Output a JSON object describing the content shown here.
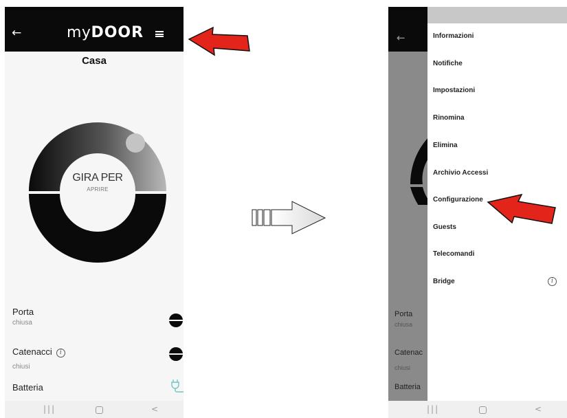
{
  "left_screen": {
    "app_bar": {
      "back_icon": "arrow-left-icon",
      "logo_my": "my",
      "logo_door": "DOOR",
      "menu_icon": "hamburger-menu-icon"
    },
    "title": "Casa",
    "dial": {
      "main_text": "GIRA PER",
      "sub_text": "APRIRE"
    },
    "status": {
      "porta": {
        "label": "Porta",
        "value": "chiusa"
      },
      "catenacci": {
        "label": "Catenacci",
        "value": "chiusi"
      },
      "batteria": {
        "label": "Batteria"
      }
    },
    "nav": {
      "recent": "|||",
      "back": "<"
    }
  },
  "right_screen": {
    "background": {
      "porta_label": "Porta",
      "porta_value": "chiusa",
      "catenacci_label": "Catenac",
      "catenacci_value": "chiusi",
      "batteria_label": "Batteria"
    },
    "drawer": {
      "items": [
        "Informazioni",
        "Notifiche",
        "Impostazioni",
        "Rinomina",
        "Elimina",
        "Archivio Accessi",
        "Configurazione",
        "Guests",
        "Telecomandi",
        "Bridge"
      ]
    },
    "nav": {
      "recent": "|||",
      "back": "<"
    }
  },
  "colors": {
    "app_bar": "#0a0a0a",
    "screen_bg": "#f6f6f6",
    "highlight_arrow": "#e3241b",
    "battery_plug": "#6fc7c0"
  }
}
